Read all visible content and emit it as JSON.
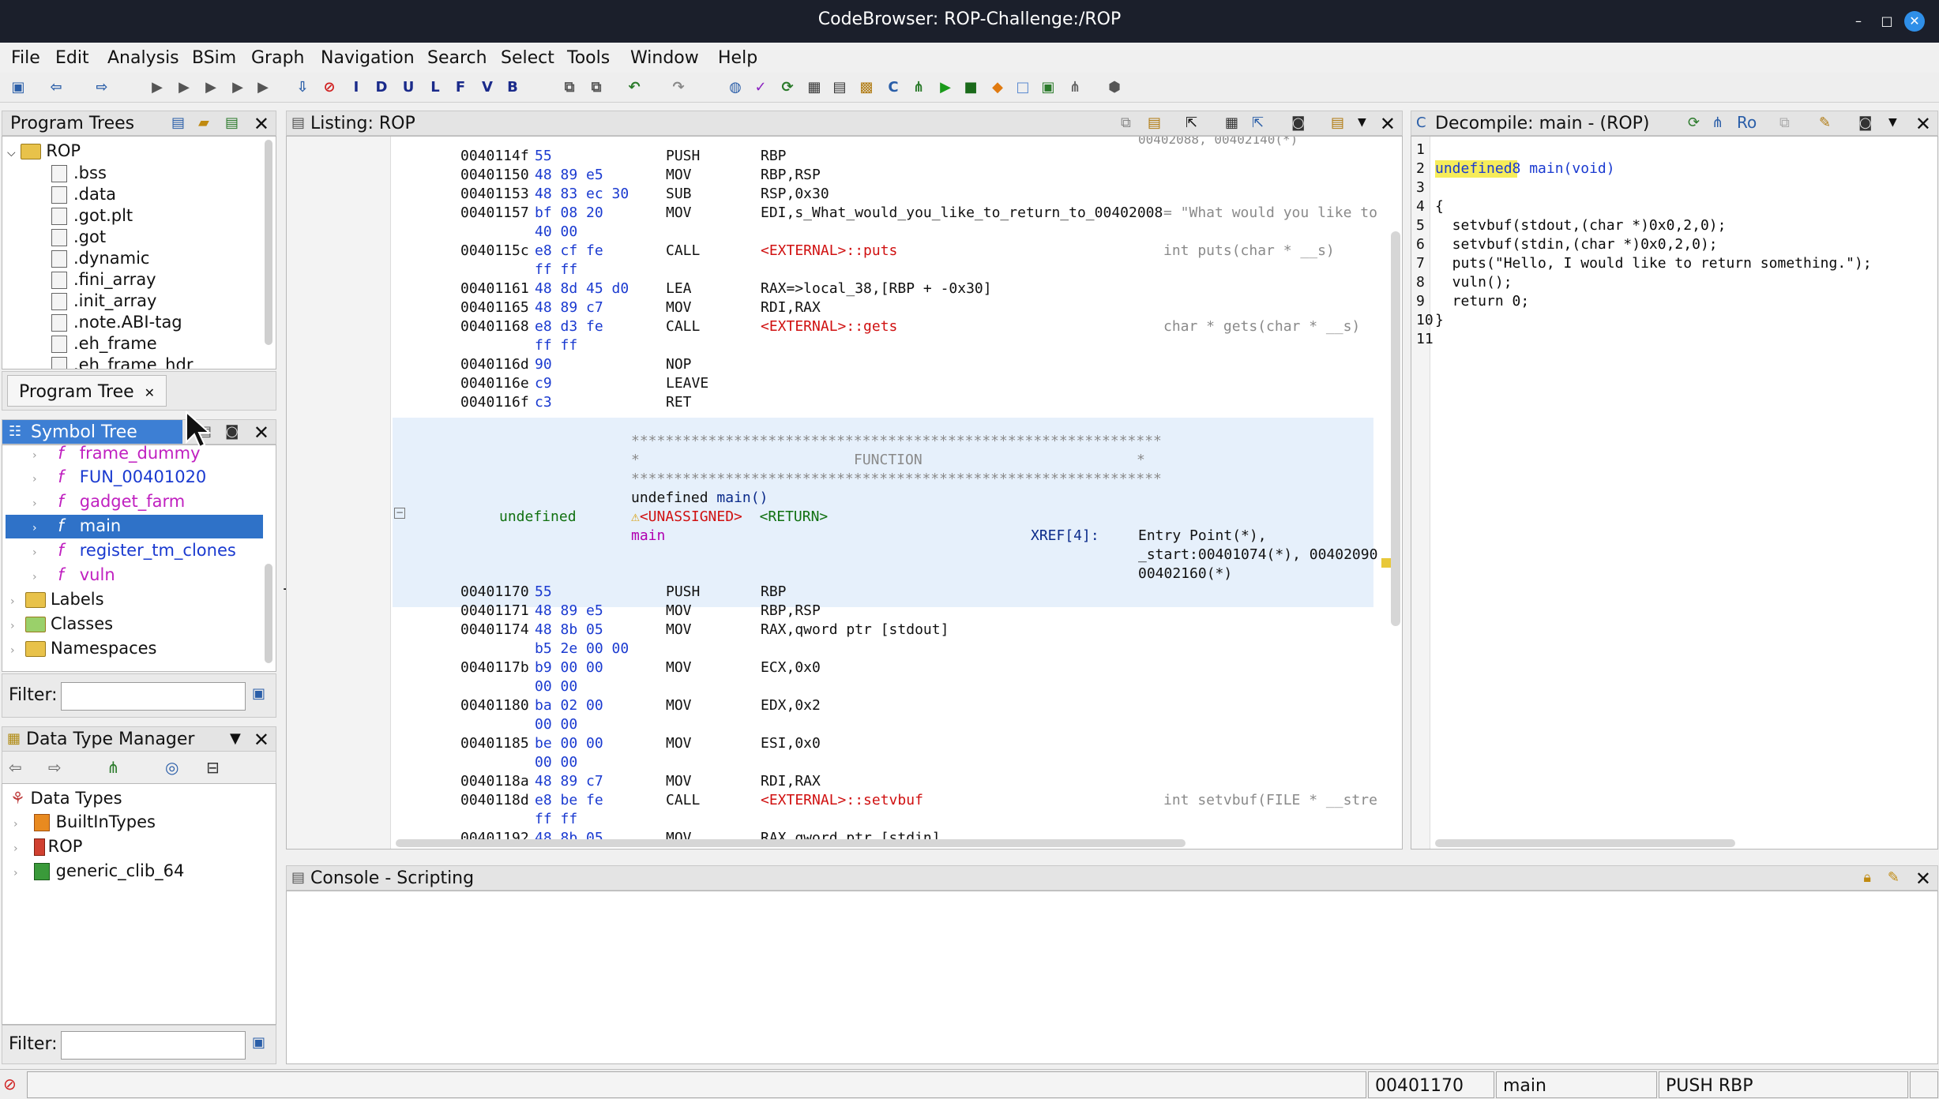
{
  "window": {
    "title": "CodeBrowser: ROP-Challenge:/ROP"
  },
  "menu": [
    "File",
    "Edit",
    "Analysis",
    "BSim",
    "Graph",
    "Navigation",
    "Search",
    "Select",
    "Tools",
    "Window",
    "Help"
  ],
  "program_trees": {
    "title": "Program Trees",
    "root": "ROP",
    "sections": [
      ".bss",
      ".data",
      ".got.plt",
      ".got",
      ".dynamic",
      ".fini_array",
      ".init_array",
      ".note.ABI-tag",
      ".eh_frame",
      ".eh_frame_hdr"
    ],
    "tab_label": "Program Tree"
  },
  "symbol_tree": {
    "title": "Symbol Tree",
    "functions": [
      {
        "name": "frame_dummy",
        "style": "fn"
      },
      {
        "name": "FUN_00401020",
        "style": "fnb"
      },
      {
        "name": "gadget_farm",
        "style": "fn"
      },
      {
        "name": "main",
        "style": "sel"
      },
      {
        "name": "register_tm_clones",
        "style": "fnb"
      },
      {
        "name": "vuln",
        "style": "fn"
      }
    ],
    "folders": [
      "Labels",
      "Classes",
      "Namespaces"
    ],
    "filter_label": "Filter:",
    "filter_value": ""
  },
  "data_type_manager": {
    "title": "Data Type Manager",
    "root": "Data Types",
    "items": [
      "BuiltInTypes",
      "ROP",
      "generic_clib_64"
    ],
    "filter_label": "Filter:",
    "filter_value": ""
  },
  "listing": {
    "title": "Listing:  ROP",
    "top_clip": "00402088, 00402140(*)",
    "rows1": [
      {
        "addr": "0040114f",
        "bytes": "55",
        "mn": "PUSH",
        "op": "RBP",
        "cmt": ""
      },
      {
        "addr": "00401150",
        "bytes": "48 89 e5",
        "mn": "MOV",
        "op": "RBP,RSP",
        "cmt": ""
      },
      {
        "addr": "00401153",
        "bytes": "48 83 ec 30",
        "mn": "SUB",
        "op": "RSP,0x30",
        "cmt": ""
      },
      {
        "addr": "00401157",
        "bytes": "bf 08 20",
        "mn": "MOV",
        "op": "EDI,s_What_would_you_like_to_return_to_00402008",
        "cmt": "= \"What would you like to"
      },
      {
        "addr": "",
        "bytes": "40 00",
        "mn": "",
        "op": "",
        "cmt": ""
      },
      {
        "addr": "0040115c",
        "bytes": "e8 cf fe",
        "mn": "CALL",
        "op": "<EXTERNAL>::puts",
        "cmt": "int puts(char * __s)"
      },
      {
        "addr": "",
        "bytes": "ff ff",
        "mn": "",
        "op": "",
        "cmt": ""
      },
      {
        "addr": "00401161",
        "bytes": "48 8d 45 d0",
        "mn": "LEA",
        "op": "RAX=>local_38,[RBP + -0x30]",
        "cmt": ""
      },
      {
        "addr": "00401165",
        "bytes": "48 89 c7",
        "mn": "MOV",
        "op": "RDI,RAX",
        "cmt": ""
      },
      {
        "addr": "00401168",
        "bytes": "e8 d3 fe",
        "mn": "CALL",
        "op": "<EXTERNAL>::gets",
        "cmt": "char * gets(char * __s)"
      },
      {
        "addr": "",
        "bytes": "ff ff",
        "mn": "",
        "op": "",
        "cmt": ""
      },
      {
        "addr": "0040116d",
        "bytes": "90",
        "mn": "NOP",
        "op": "",
        "cmt": ""
      },
      {
        "addr": "0040116e",
        "bytes": "c9",
        "mn": "LEAVE",
        "op": "",
        "cmt": ""
      },
      {
        "addr": "0040116f",
        "bytes": "c3",
        "mn": "RET",
        "op": "",
        "cmt": ""
      }
    ],
    "func_header": {
      "stars": "**************************************************************",
      "star_left": "*",
      "function_label": "FUNCTION",
      "star_right": "*",
      "ret_type": "undefined",
      "sig_prefix": "undefined",
      "sig_name": "main()",
      "unassigned": "<UNASSIGNED>",
      "ret": "<RETURN>",
      "label": "main",
      "xref": "XREF[4]:",
      "xref1": "Entry Point(*),",
      "xref2": "_start:00401074(*), 00402090",
      "xref3": "00402160(*)"
    },
    "rows2": [
      {
        "addr": "00401170",
        "bytes": "55",
        "mn": "PUSH",
        "op": "RBP",
        "cmt": ""
      },
      {
        "addr": "00401171",
        "bytes": "48 89 e5",
        "mn": "MOV",
        "op": "RBP,RSP",
        "cmt": ""
      },
      {
        "addr": "00401174",
        "bytes": "48 8b 05",
        "mn": "MOV",
        "op": "RAX,qword ptr [stdout]",
        "cmt": ""
      },
      {
        "addr": "",
        "bytes": "b5 2e 00 00",
        "mn": "",
        "op": "",
        "cmt": ""
      },
      {
        "addr": "0040117b",
        "bytes": "b9 00 00",
        "mn": "MOV",
        "op": "ECX,0x0",
        "cmt": ""
      },
      {
        "addr": "",
        "bytes": "00 00",
        "mn": "",
        "op": "",
        "cmt": ""
      },
      {
        "addr": "00401180",
        "bytes": "ba 02 00",
        "mn": "MOV",
        "op": "EDX,0x2",
        "cmt": ""
      },
      {
        "addr": "",
        "bytes": "00 00",
        "mn": "",
        "op": "",
        "cmt": ""
      },
      {
        "addr": "00401185",
        "bytes": "be 00 00",
        "mn": "MOV",
        "op": "ESI,0x0",
        "cmt": ""
      },
      {
        "addr": "",
        "bytes": "00 00",
        "mn": "",
        "op": "",
        "cmt": ""
      },
      {
        "addr": "0040118a",
        "bytes": "48 89 c7",
        "mn": "MOV",
        "op": "RDI,RAX",
        "cmt": ""
      },
      {
        "addr": "0040118d",
        "bytes": "e8 be fe",
        "mn": "CALL",
        "op": "<EXTERNAL>::setvbuf",
        "cmt": "int setvbuf(FILE * __stre"
      },
      {
        "addr": "",
        "bytes": "ff ff",
        "mn": "",
        "op": "",
        "cmt": ""
      },
      {
        "addr": "00401192",
        "bytes": "48 8b 05",
        "mn": "MOV",
        "op": "RAX,qword ptr [stdin]",
        "cmt": ""
      }
    ]
  },
  "decompile": {
    "title": "Decompile: main - (ROP)",
    "ro": "Ro",
    "lines": [
      {
        "n": "1",
        "code": ""
      },
      {
        "n": "2",
        "code": "undefined8 main(void)"
      },
      {
        "n": "3",
        "code": ""
      },
      {
        "n": "4",
        "code": "{"
      },
      {
        "n": "5",
        "code": "  setvbuf(stdout,(char *)0x0,2,0);"
      },
      {
        "n": "6",
        "code": "  setvbuf(stdin,(char *)0x0,2,0);"
      },
      {
        "n": "7",
        "code": "  puts(\"Hello, I would like to return something.\");"
      },
      {
        "n": "8",
        "code": "  vuln();"
      },
      {
        "n": "9",
        "code": "  return 0;"
      },
      {
        "n": "10",
        "code": "}"
      },
      {
        "n": "11",
        "code": ""
      }
    ]
  },
  "console": {
    "title": "Console - Scripting"
  },
  "status": {
    "address": "00401170",
    "function": "main",
    "instruction": "PUSH RBP"
  }
}
